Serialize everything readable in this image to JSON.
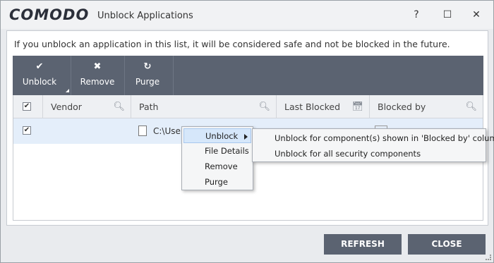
{
  "window": {
    "logo": "COMODO",
    "title": "Unblock Applications",
    "help": "?",
    "maximize": "☐",
    "close": "✕"
  },
  "info_text": "If you unblock an application in this list, it will be considered safe and not be blocked in the future.",
  "toolbar": {
    "unblock": {
      "icon": "check-icon",
      "glyph": "✔",
      "label": "Unblock"
    },
    "remove": {
      "icon": "x-icon",
      "glyph": "✖",
      "label": "Remove"
    },
    "purge": {
      "icon": "refresh-icon",
      "glyph": "↻",
      "label": "Purge"
    }
  },
  "table": {
    "columns": [
      {
        "label": "Vendor",
        "search_icon": "search-icon"
      },
      {
        "label": "Path",
        "search_icon": "search-icon"
      },
      {
        "label": "Last Blocked",
        "icon": "calendar-icon"
      },
      {
        "label": "Blocked by",
        "search_icon": "search-icon"
      }
    ],
    "header_checked": "✔",
    "rows": [
      {
        "checked": "✔",
        "vendor": "",
        "path": "C:\\Users",
        "last_blocked": "",
        "blocked_by": ""
      }
    ]
  },
  "context_menu": {
    "items": [
      "Unblock",
      "File Details",
      "Remove",
      "Purge"
    ],
    "active": "Unblock"
  },
  "submenu": {
    "items": [
      "Unblock for component(s) shown in 'Blocked by' column",
      "Unblock for all security components"
    ]
  },
  "buttons": {
    "refresh": "REFRESH",
    "close": "CLOSE"
  },
  "colors": {
    "toolbar_bg": "#5b6371",
    "row_selected": "#e4eefa",
    "menu_highlight": "#d6e7fa"
  }
}
